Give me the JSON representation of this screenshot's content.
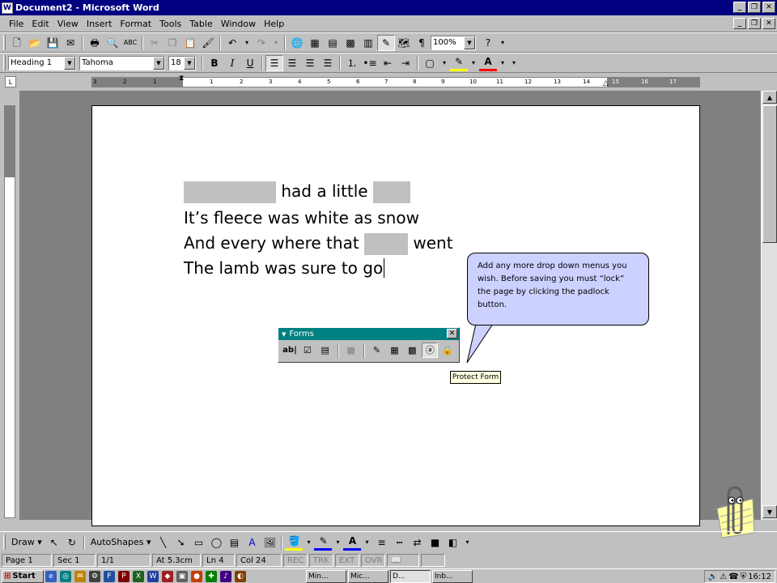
{
  "window": {
    "title": "Document2 - Microsoft Word",
    "icon": "word-icon"
  },
  "menu": {
    "items": [
      "File",
      "Edit",
      "View",
      "Insert",
      "Format",
      "Tools",
      "Table",
      "Window",
      "Help"
    ]
  },
  "standard_toolbar": {
    "zoom": "100%"
  },
  "formatting_toolbar": {
    "style": "Heading 1",
    "font": "Tahoma",
    "size": "18",
    "bold": "B",
    "italic": "I",
    "underline": "U"
  },
  "ruler": {
    "ticks": [
      "3",
      "2",
      "1",
      "1",
      "2",
      "3",
      "4",
      "5",
      "6",
      "7",
      "8",
      "9",
      "10",
      "11",
      "12",
      "13",
      "14",
      "15",
      "16",
      "17"
    ]
  },
  "document": {
    "line1_text": "had a little",
    "line2": "It’s fleece was white as snow",
    "line3_before": "And every where that",
    "line3_after": "went",
    "line4": "The lamb was sure to go"
  },
  "callout": {
    "text": "Add any more drop down menus you wish. Before saving you must “lock” the page by clicking the padlock button."
  },
  "forms_toolbar": {
    "title": "Forms",
    "text_field_label": "ab|"
  },
  "tooltip": {
    "text": "Protect Form"
  },
  "drawing_toolbar": {
    "draw": "Draw ▾",
    "autoshapes": "AutoShapes ▾"
  },
  "status": {
    "page": "Page 1",
    "sec": "Sec 1",
    "pages": "1/1",
    "at": "At 5.3cm",
    "ln": "Ln 4",
    "col": "Col 24",
    "rec": "REC",
    "trk": "TRK",
    "ext": "EXT",
    "ovr": "OVR"
  },
  "taskbar": {
    "start": "Start",
    "tasks": [
      "Min...",
      "Mic...",
      "D...",
      "Inb..."
    ],
    "clock": "16:12"
  }
}
